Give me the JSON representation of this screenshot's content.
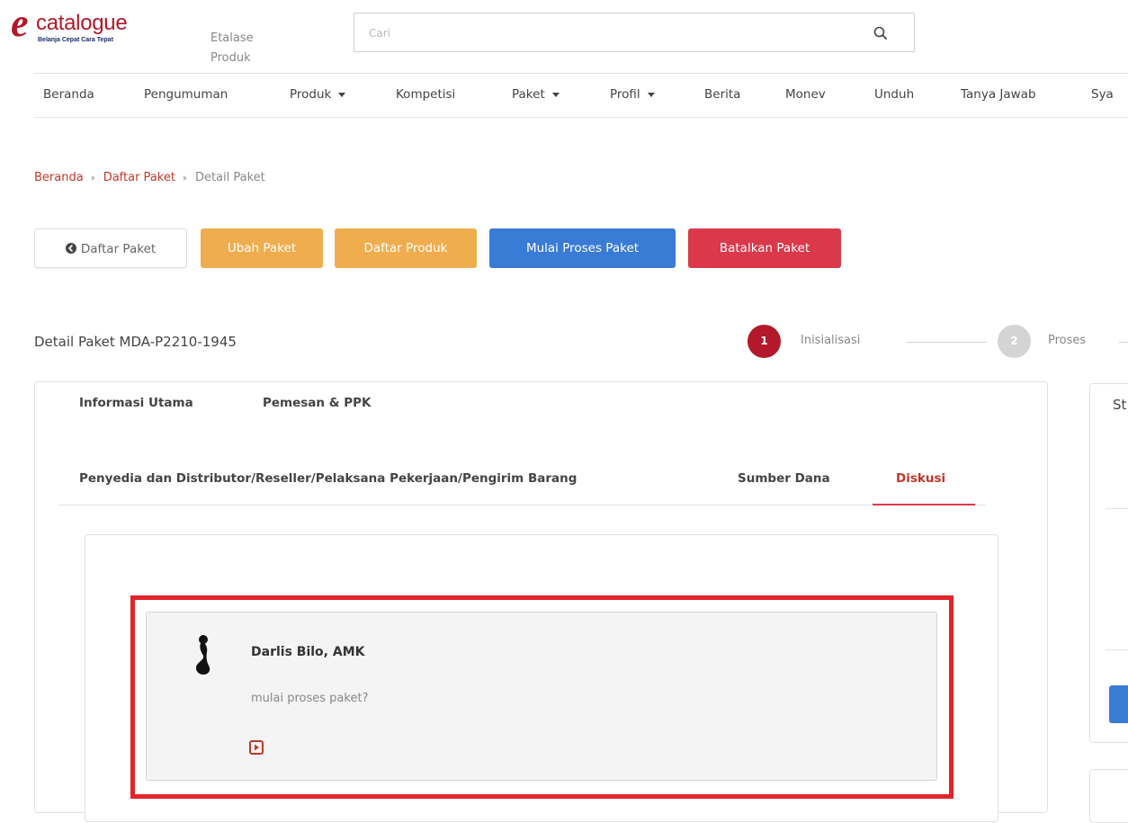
{
  "logo": {
    "letter": "e",
    "word": "catalogue",
    "tagline": "Belanja Cepat Cara Tepat"
  },
  "header": {
    "etalase_label": "Etalase Produk",
    "search_placeholder": "Cari",
    "search_value": ""
  },
  "nav": {
    "items": [
      "Beranda",
      "Pengumuman",
      "Produk",
      "Kompetisi",
      "Paket",
      "Profil",
      "Berita",
      "Monev",
      "Unduh",
      "Tanya Jawab",
      "Sya"
    ]
  },
  "breadcrumb": [
    "Beranda",
    "Daftar Paket",
    "Detail Paket"
  ],
  "actions": {
    "back": "Daftar Paket",
    "ubah": "Ubah Paket",
    "daftar_produk": "Daftar Produk",
    "mulai": "Mulai Proses Paket",
    "batalkan": "Batalkan Paket"
  },
  "detail": {
    "title": "Detail Paket MDA-P2210-1945"
  },
  "stepper": [
    {
      "number": "1",
      "label": "Inisialisasi",
      "active": true
    },
    {
      "number": "2",
      "label": "Proses",
      "active": false
    }
  ],
  "tabs": [
    "Informasi Utama",
    "Pemesan & PPK",
    "Penyedia dan Distributor/Reseller/Pelaksana Pekerjaan/Pengirim Barang",
    "Sumber Dana",
    "Diskusi"
  ],
  "active_tab": "Diskusi",
  "comment": {
    "author": "Darlis Bilo, AMK",
    "message": "mulai proses paket?"
  },
  "side_panel": {
    "label": "St"
  },
  "colors": {
    "brand": "#b3192b",
    "warning": "#f0ad4e",
    "primary": "#3a7bd5",
    "danger": "#d9394a",
    "highlight": "#e3242b"
  }
}
